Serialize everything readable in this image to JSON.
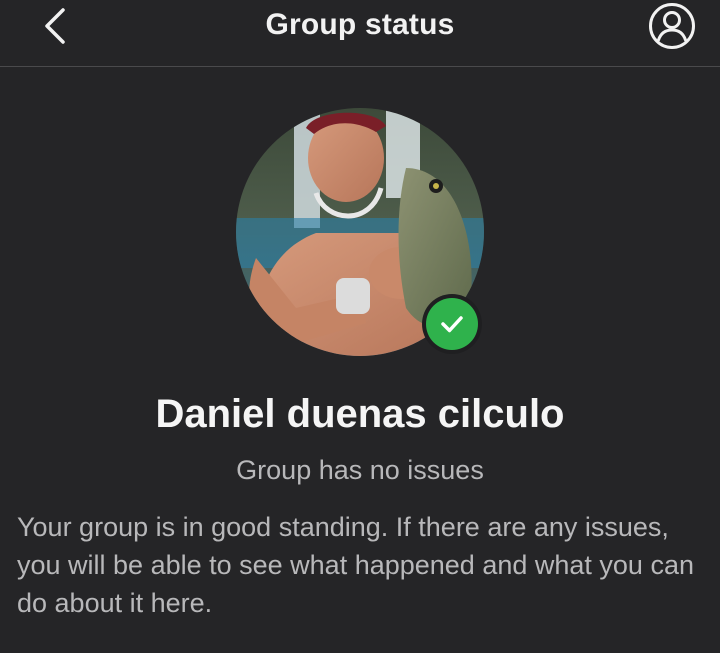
{
  "header": {
    "title": "Group status",
    "back_icon": "chevron-left-icon",
    "profile_icon": "user-circle-icon"
  },
  "group": {
    "name": "Daniel duenas cilculo",
    "status": "Group has no issues",
    "description": "Your group is in good standing. If there are any issues, you will be able to see what happened and what you can do about it here.",
    "verified_icon": "checkmark-icon"
  },
  "colors": {
    "background": "#252527",
    "badge_green": "#2fb24c",
    "muted_text": "#b8b8ba"
  }
}
